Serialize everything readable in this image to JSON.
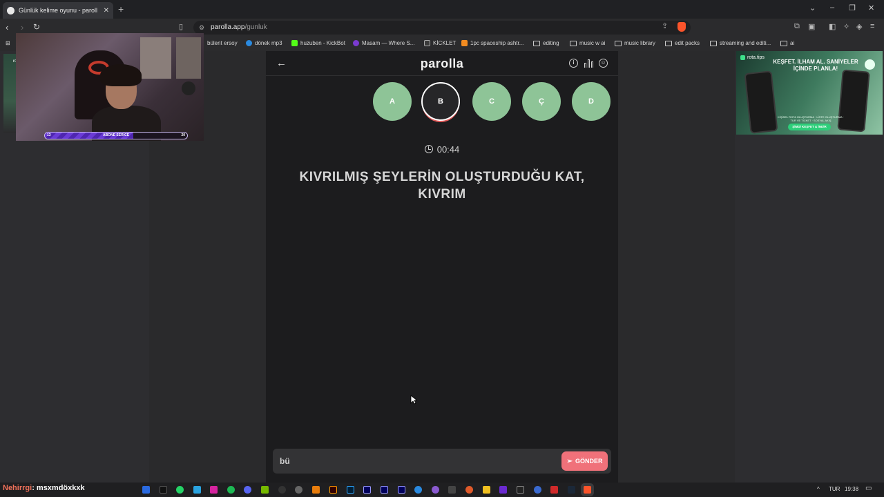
{
  "browser": {
    "tab_title": "Günlük kelime oyunu - paroll",
    "url_host": "parolla.app",
    "url_path": "/gunluk",
    "bookmarks": [
      {
        "label": "bülent ersoy",
        "icon": "none"
      },
      {
        "label": "dönek mp3",
        "icon": "edge-icon"
      },
      {
        "label": "huzuben - KickBot",
        "icon": "kickbot-icon"
      },
      {
        "label": "Masam — Where S...",
        "icon": "masam-icon"
      },
      {
        "label": "KİCKLET",
        "icon": "kicklet-icon"
      },
      {
        "label": "1pc spaceship ashtr...",
        "icon": "spaceship-icon"
      },
      {
        "label": "editing",
        "icon": "folder-icon"
      },
      {
        "label": "music w ai",
        "icon": "folder-icon"
      },
      {
        "label": "music library",
        "icon": "folder-icon"
      },
      {
        "label": "edit packs",
        "icon": "folder-icon"
      },
      {
        "label": "streaming and editi...",
        "icon": "folder-icon"
      },
      {
        "label": "ai",
        "icon": "folder-icon"
      }
    ],
    "left_thumb_label": "ro"
  },
  "app": {
    "logo": "parolla",
    "letters": [
      "A",
      "B",
      "C",
      "Ç",
      "D"
    ],
    "active_letter": "B",
    "timer": "00:44",
    "question": "KIVRILMIŞ ŞEYLERİN OLUŞTURDUĞU KAT, KIVRIM",
    "answer_value": "bü",
    "send_label": "GÖNDER"
  },
  "colors": {
    "letter_circle": "#8ec497",
    "send_button": "#f0717a",
    "active_ring_accent": "#e05a5a"
  },
  "webcam": {
    "xp_left": "13",
    "xp_label": "ABONE SERİCE",
    "xp_right": "20",
    "xp_progress": 0.62
  },
  "ad": {
    "brand": "rota.tips",
    "headline": "KEŞFET. İLHAM AL. SANİYELER İÇİNDE PLANLA!",
    "sub": "KİŞİSEL ROTA OLUŞTURMA · LİSTE OLUŞTURMA · TUR VE TICKET · SOSYAL AKIŞ",
    "cta": "ŞİMDİ KEŞFET & İNDİR"
  },
  "taskbar": {
    "chat_user": "Nehirrgi",
    "chat_message": ": msxmdöxkxk",
    "lang": "TUR",
    "time": "19:38"
  }
}
